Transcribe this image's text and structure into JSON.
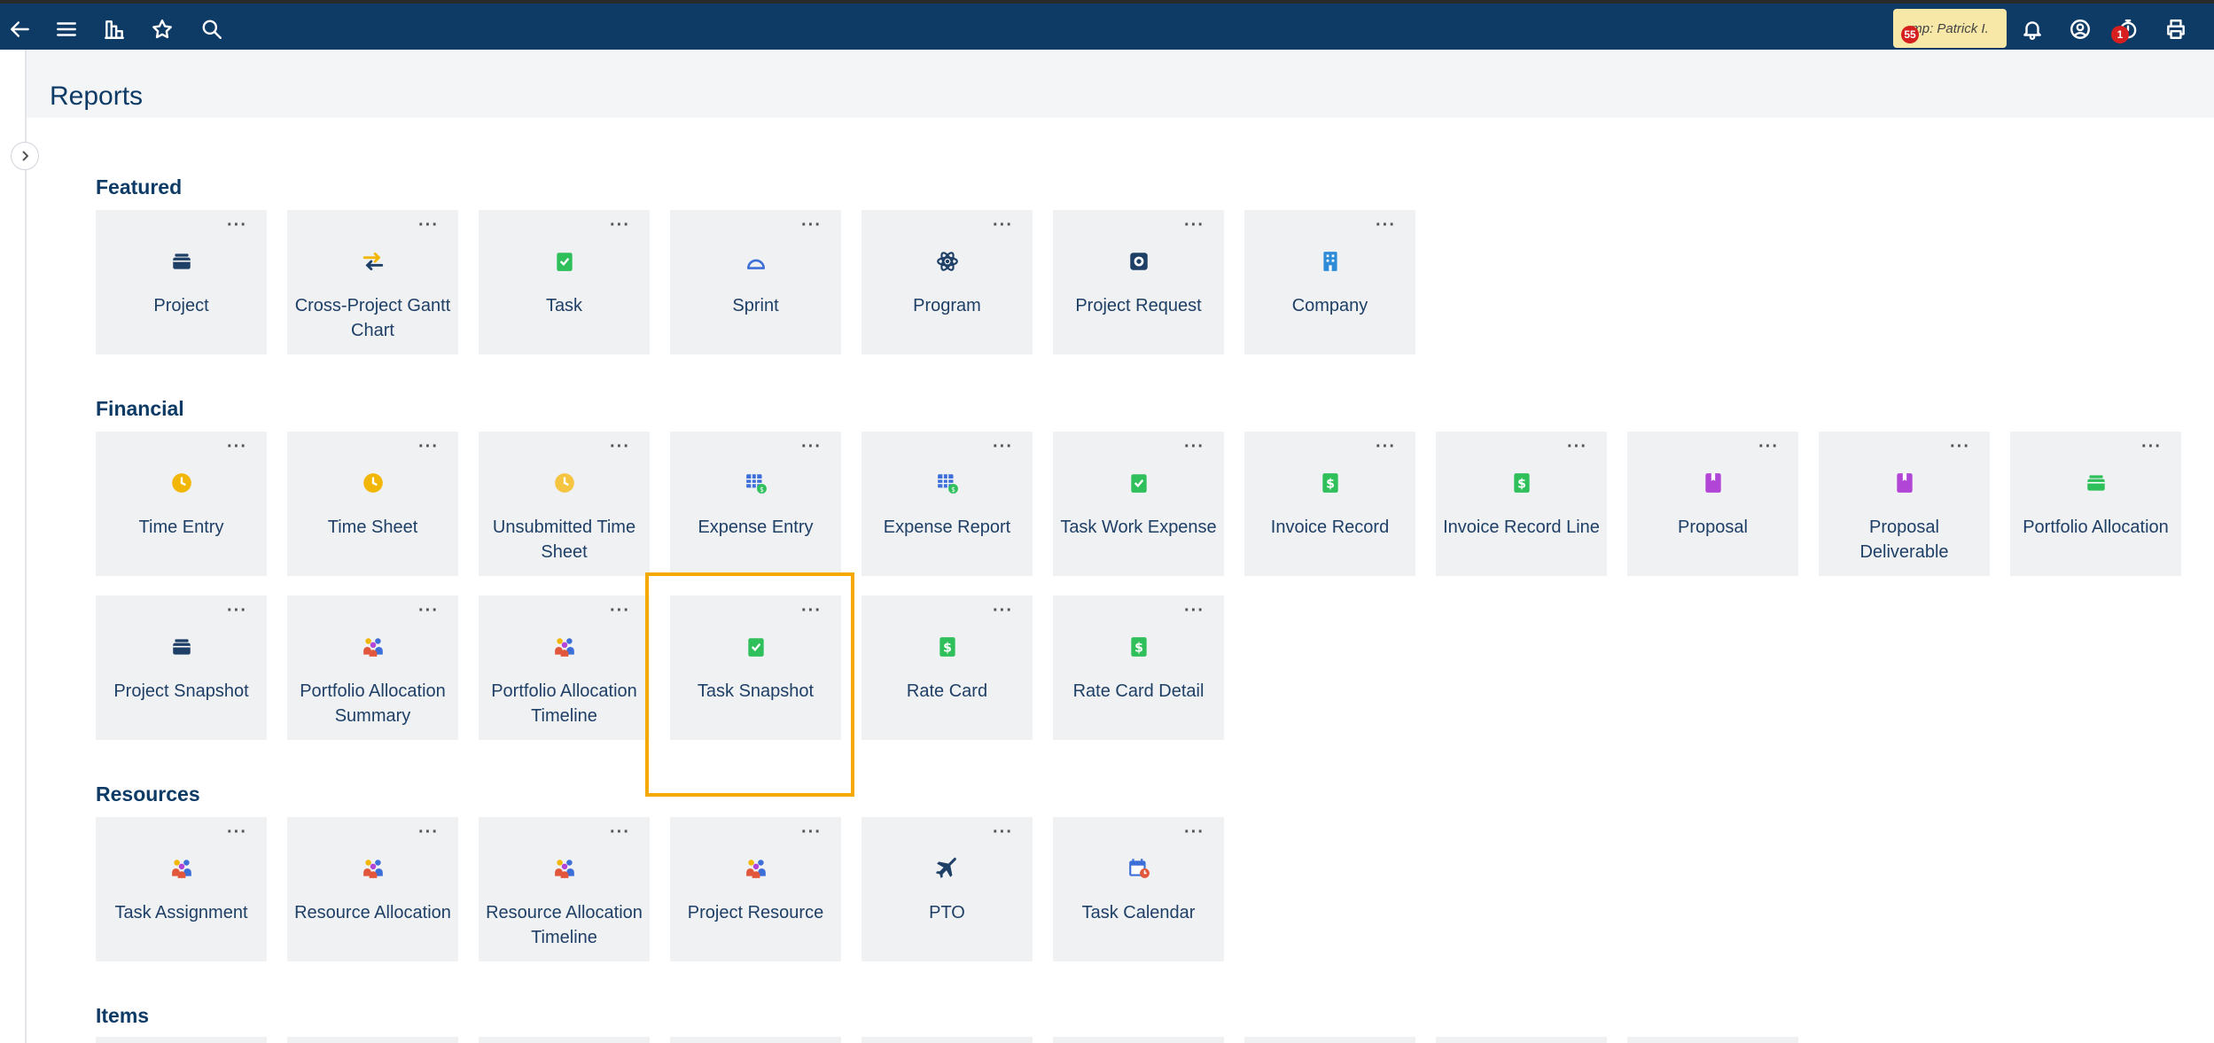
{
  "topbar": {
    "user_chip": "mp: Patrick I.",
    "user_badge": "55",
    "timer_badge": "1"
  },
  "page": {
    "title": "Reports"
  },
  "sections": {
    "featured": {
      "title": "Featured",
      "cards": [
        {
          "label": "Project",
          "icon": "stack-icon"
        },
        {
          "label": "Cross-Project Gantt Chart",
          "icon": "arrows-exchange-icon"
        },
        {
          "label": "Task",
          "icon": "clipboard-check-icon"
        },
        {
          "label": "Sprint",
          "icon": "sprint-icon"
        },
        {
          "label": "Program",
          "icon": "atom-icon"
        },
        {
          "label": "Project Request",
          "icon": "safe-icon"
        },
        {
          "label": "Company",
          "icon": "building-icon"
        }
      ]
    },
    "financial": {
      "title": "Financial",
      "cards": [
        {
          "label": "Time Entry",
          "icon": "clock-icon"
        },
        {
          "label": "Time Sheet",
          "icon": "clock-icon"
        },
        {
          "label": "Unsubmitted Time Sheet",
          "icon": "clock-icon"
        },
        {
          "label": "Expense Entry",
          "icon": "expense-grid-icon"
        },
        {
          "label": "Expense Report",
          "icon": "expense-grid-icon"
        },
        {
          "label": "Task Work Expense",
          "icon": "clipboard-check-icon"
        },
        {
          "label": "Invoice Record",
          "icon": "dollar-doc-icon"
        },
        {
          "label": "Invoice Record Line",
          "icon": "dollar-doc-icon"
        },
        {
          "label": "Proposal",
          "icon": "book-icon"
        },
        {
          "label": "Proposal Deliverable",
          "icon": "book-icon"
        },
        {
          "label": "Portfolio Allocation",
          "icon": "green-stack-icon"
        },
        {
          "label": "Project Snapshot",
          "icon": "stack-icon"
        },
        {
          "label": "Portfolio Allocation Summary",
          "icon": "people-icon"
        },
        {
          "label": "Portfolio Allocation Timeline",
          "icon": "people-icon"
        },
        {
          "label": "Task Snapshot",
          "icon": "clipboard-check-icon"
        },
        {
          "label": "Rate Card",
          "icon": "dollar-doc-icon"
        },
        {
          "label": "Rate Card Detail",
          "icon": "dollar-doc-icon"
        }
      ]
    },
    "resources": {
      "title": "Resources",
      "cards": [
        {
          "label": "Task Assignment",
          "icon": "people-icon"
        },
        {
          "label": "Resource Allocation",
          "icon": "people-icon"
        },
        {
          "label": "Resource Allocation Timeline",
          "icon": "people-icon"
        },
        {
          "label": "Project Resource",
          "icon": "people-icon"
        },
        {
          "label": "PTO",
          "icon": "airplane-icon"
        },
        {
          "label": "Task Calendar",
          "icon": "calendar-icon"
        }
      ]
    },
    "items": {
      "title": "Items"
    }
  },
  "colors": {
    "nav": "#0d3b66",
    "highlight": "#f4a900",
    "card_bg": "#f0f1f2"
  }
}
